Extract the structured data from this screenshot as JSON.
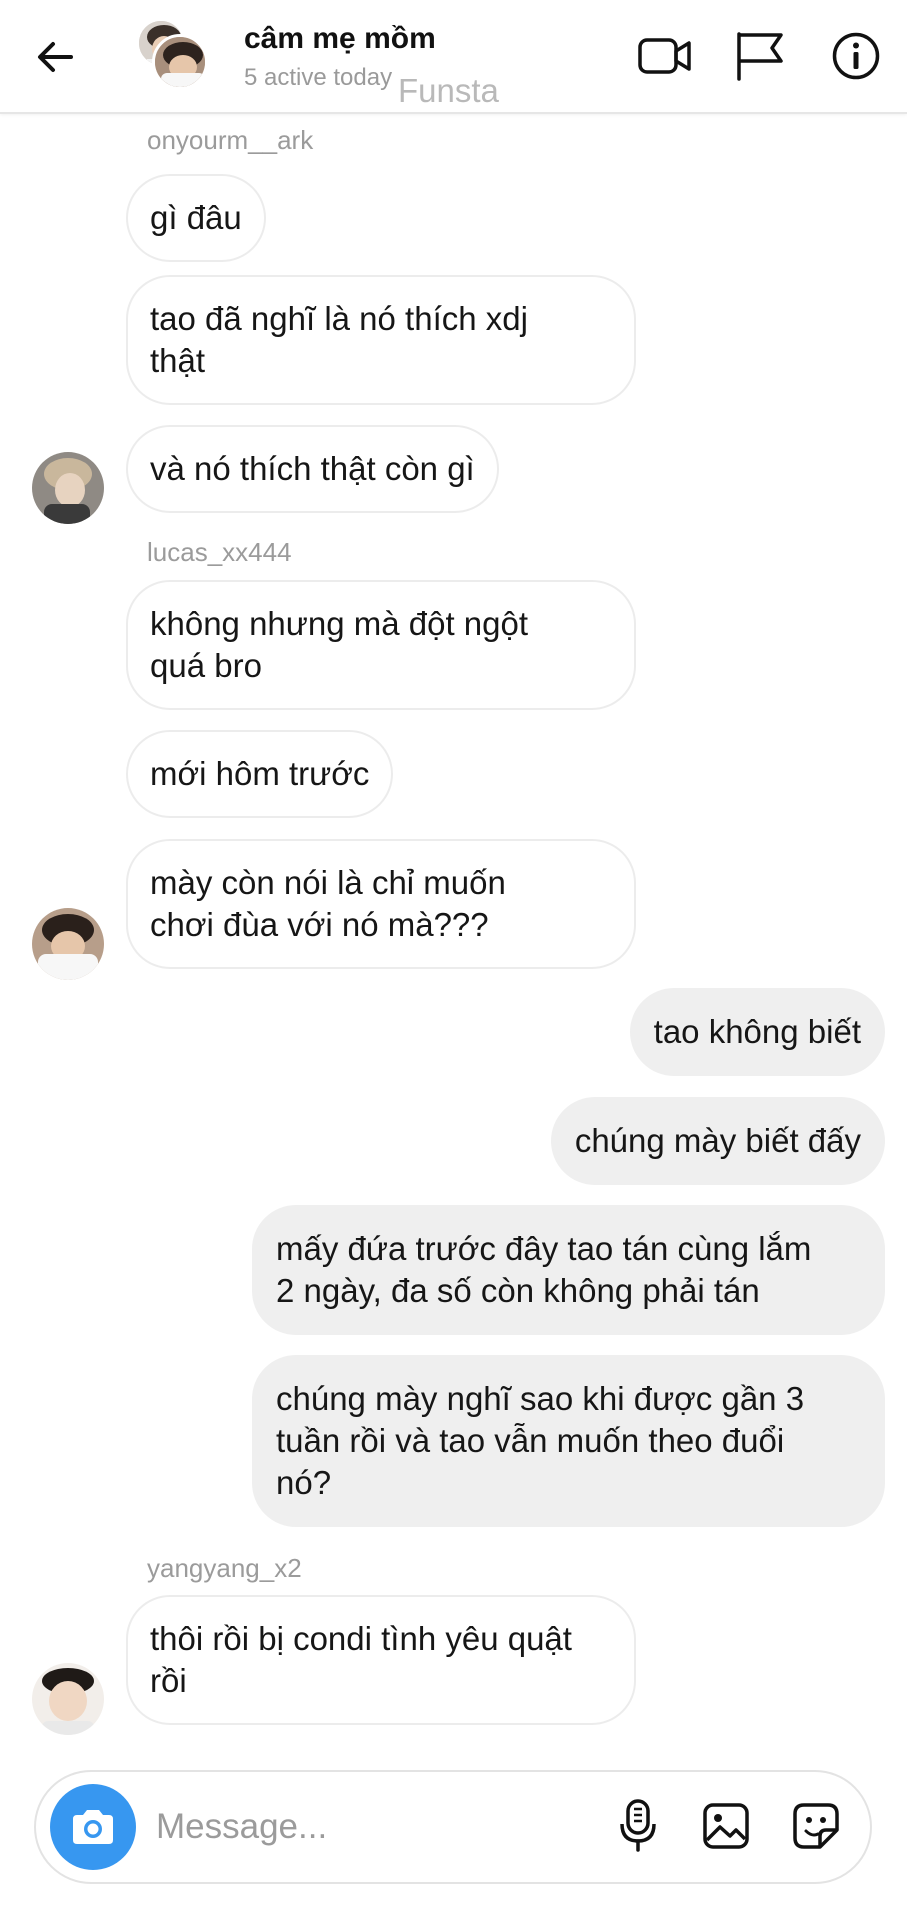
{
  "header": {
    "title": "câm mẹ mồm",
    "status": "5 active today",
    "watermark": "Funsta",
    "icons": [
      "back-arrow-icon",
      "video-call-icon",
      "flag-icon",
      "info-icon"
    ]
  },
  "messages": [
    {
      "type": "sender",
      "text": "onyourm__ark"
    },
    {
      "type": "in",
      "text": "gì đâu"
    },
    {
      "type": "in",
      "text": "tao đã nghĩ là nó thích xdj\nthật"
    },
    {
      "type": "in",
      "text": "và nó thích thật còn gì",
      "avatar": true
    },
    {
      "type": "sender",
      "text": "lucas_xx444"
    },
    {
      "type": "in",
      "text": "không nhưng mà đột ngột\nquá bro"
    },
    {
      "type": "in",
      "text": "mới hôm trước"
    },
    {
      "type": "in",
      "text": "mày còn nói là chỉ muốn\nchơi đùa với nó mà???",
      "avatar": true
    },
    {
      "type": "out",
      "text": "tao không biết"
    },
    {
      "type": "out",
      "text": "chúng mày biết đấy"
    },
    {
      "type": "out",
      "text": "mấy đứa trước đây tao tán cùng lắm\n2 ngày, đa số còn không phải tán"
    },
    {
      "type": "out",
      "text": "chúng mày nghĩ sao khi được gần 3\ntuần rồi và tao vẫn muốn theo đuổi\nnó?"
    },
    {
      "type": "sender",
      "text": "yangyang_x2"
    },
    {
      "type": "in",
      "text": "thôi rồi bị condi tình yêu quật\nrồi",
      "avatar": true
    }
  ],
  "composer": {
    "placeholder": "Message...",
    "icons": [
      "camera-icon",
      "microphone-icon",
      "gallery-icon",
      "sticker-icon"
    ]
  },
  "colors": {
    "accent": "#3797f0",
    "outgoing_bubble": "#efefef",
    "incoming_border": "#ececec",
    "secondary_text": "#9b9b9b"
  }
}
